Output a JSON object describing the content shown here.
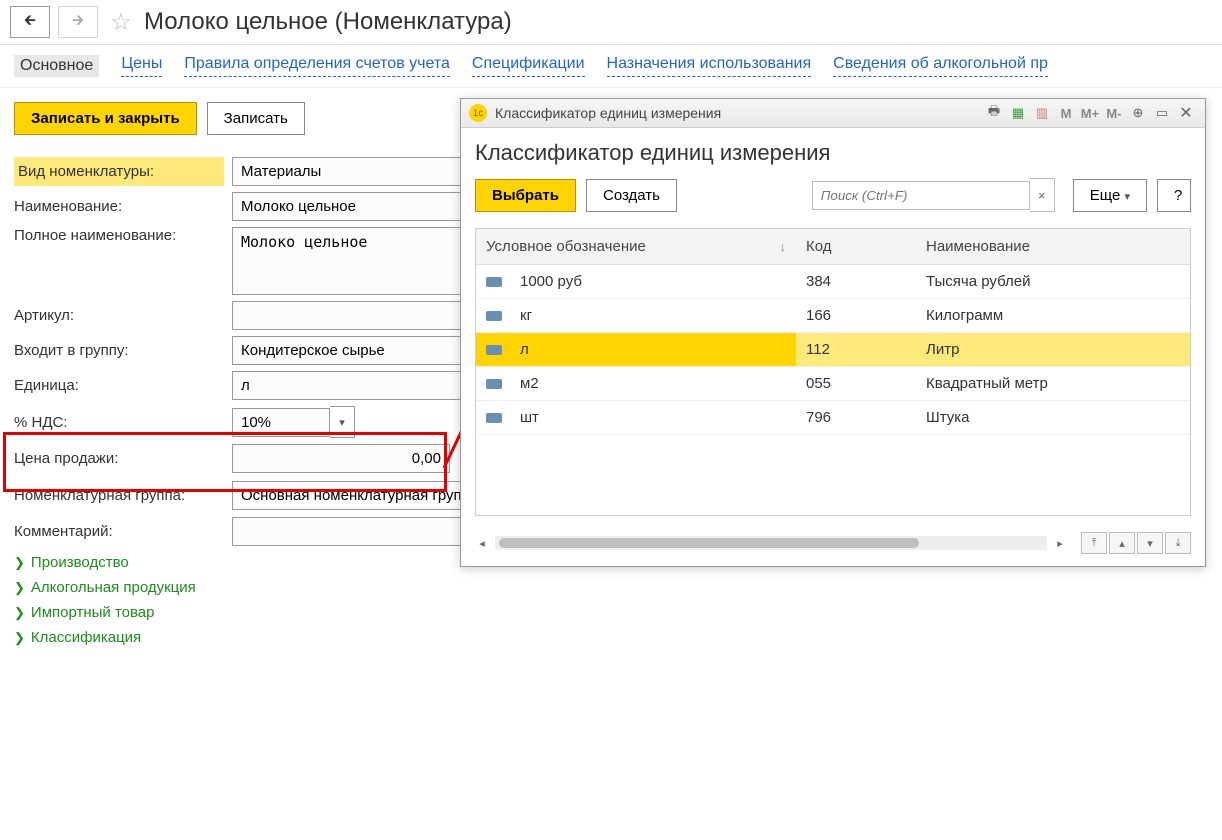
{
  "header": {
    "title": "Молоко цельное (Номенклатура)"
  },
  "tabs": [
    "Основное",
    "Цены",
    "Правила определения счетов учета",
    "Спецификации",
    "Назначения использования",
    "Сведения об алкогольной пр"
  ],
  "toolbar": {
    "save_close": "Записать и закрыть",
    "save": "Записать"
  },
  "form": {
    "kind_label": "Вид номенклатуры:",
    "kind_value": "Материалы",
    "name_label": "Наименование:",
    "name_value": "Молоко цельное",
    "fullname_label": "Полное наименование:",
    "fullname_value": "Молоко цельное",
    "article_label": "Артикул:",
    "article_value": "",
    "group_label": "Входит в группу:",
    "group_value": "Кондитерское сырье",
    "unit_label": "Единица:",
    "unit_value": "л",
    "vat_label": "% НДС:",
    "vat_value": "10%",
    "saleprice_label": "Цена продажи:",
    "saleprice_value": "0,00",
    "nomgroup_label": "Номенклатурная группа:",
    "nomgroup_value": "Основная номенклатурная группа",
    "comment_label": "Комментарий:",
    "comment_value": ""
  },
  "expanders": [
    "Производство",
    "Алкогольная продукция",
    "Импортный товар",
    "Классификация"
  ],
  "dialog": {
    "title": "Классификатор единиц измерения",
    "header": "Классификатор единиц измерения",
    "select": "Выбрать",
    "create": "Создать",
    "search_ph": "Поиск (Ctrl+F)",
    "more": "Еще",
    "help": "?",
    "col1": "Условное обозначение",
    "col2": "Код",
    "col3": "Наименование",
    "rows": [
      {
        "s": "1000 руб",
        "c": "384",
        "n": "Тысяча рублей"
      },
      {
        "s": "кг",
        "c": "166",
        "n": "Килограмм"
      },
      {
        "s": "л",
        "c": "112",
        "n": "Литр"
      },
      {
        "s": "м2",
        "c": "055",
        "n": "Квадратный метр"
      },
      {
        "s": "шт",
        "c": "796",
        "n": "Штука"
      }
    ],
    "selected_index": 2
  }
}
